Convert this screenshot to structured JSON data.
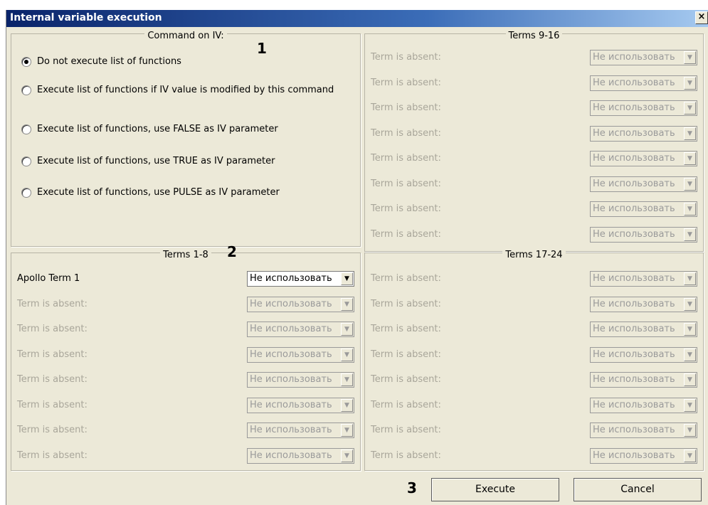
{
  "window": {
    "title": "Internal variable execution",
    "close_label": "×"
  },
  "markers": {
    "m1": "1",
    "m2": "2",
    "m3": "3"
  },
  "command_group": {
    "title": "Command on IV:",
    "options": [
      {
        "label": "Do not execute list of functions",
        "checked": true
      },
      {
        "label": "Execute list of functions if IV value is modified by this command",
        "checked": false
      },
      {
        "label": "Execute list of functions, use FALSE as IV parameter",
        "checked": false
      },
      {
        "label": "Execute list of functions, use TRUE as IV parameter",
        "checked": false
      },
      {
        "label": "Execute list of functions, use PULSE as IV parameter",
        "checked": false
      }
    ]
  },
  "terms_1_8": {
    "title": "Terms 1-8",
    "rows": [
      {
        "label": "Apollo Term 1",
        "value": "Не использовать",
        "enabled": true
      },
      {
        "label": "Term is absent:",
        "value": "Не использовать",
        "enabled": false
      },
      {
        "label": "Term is absent:",
        "value": "Не использовать",
        "enabled": false
      },
      {
        "label": "Term is absent:",
        "value": "Не использовать",
        "enabled": false
      },
      {
        "label": "Term is absent:",
        "value": "Не использовать",
        "enabled": false
      },
      {
        "label": "Term is absent:",
        "value": "Не использовать",
        "enabled": false
      },
      {
        "label": "Term is absent:",
        "value": "Не использовать",
        "enabled": false
      },
      {
        "label": "Term is absent:",
        "value": "Не использовать",
        "enabled": false
      }
    ]
  },
  "terms_9_16": {
    "title": "Terms 9-16",
    "rows": [
      {
        "label": "Term is absent:",
        "value": "Не использовать",
        "enabled": false
      },
      {
        "label": "Term is absent:",
        "value": "Не использовать",
        "enabled": false
      },
      {
        "label": "Term is absent:",
        "value": "Не использовать",
        "enabled": false
      },
      {
        "label": "Term is absent:",
        "value": "Не использовать",
        "enabled": false
      },
      {
        "label": "Term is absent:",
        "value": "Не использовать",
        "enabled": false
      },
      {
        "label": "Term is absent:",
        "value": "Не использовать",
        "enabled": false
      },
      {
        "label": "Term is absent:",
        "value": "Не использовать",
        "enabled": false
      },
      {
        "label": "Term is absent:",
        "value": "Не использовать",
        "enabled": false
      }
    ]
  },
  "terms_17_24": {
    "title": "Terms 17-24",
    "rows": [
      {
        "label": "Term is absent:",
        "value": "Не использовать",
        "enabled": false
      },
      {
        "label": "Term is absent:",
        "value": "Не использовать",
        "enabled": false
      },
      {
        "label": "Term is absent:",
        "value": "Не использовать",
        "enabled": false
      },
      {
        "label": "Term is absent:",
        "value": "Не использовать",
        "enabled": false
      },
      {
        "label": "Term is absent:",
        "value": "Не использовать",
        "enabled": false
      },
      {
        "label": "Term is absent:",
        "value": "Не использовать",
        "enabled": false
      },
      {
        "label": "Term is absent:",
        "value": "Не использовать",
        "enabled": false
      },
      {
        "label": "Term is absent:",
        "value": "Не использовать",
        "enabled": false
      }
    ]
  },
  "buttons": {
    "execute": "Execute",
    "cancel": "Cancel"
  },
  "icons": {
    "dropdown": "chevron-down-icon",
    "close": "close-icon"
  },
  "colors": {
    "titlebar_start": "#0a246a",
    "titlebar_end": "#a6caf0",
    "dialog_bg": "#ece9d8",
    "disabled_text": "#a9a69a"
  }
}
